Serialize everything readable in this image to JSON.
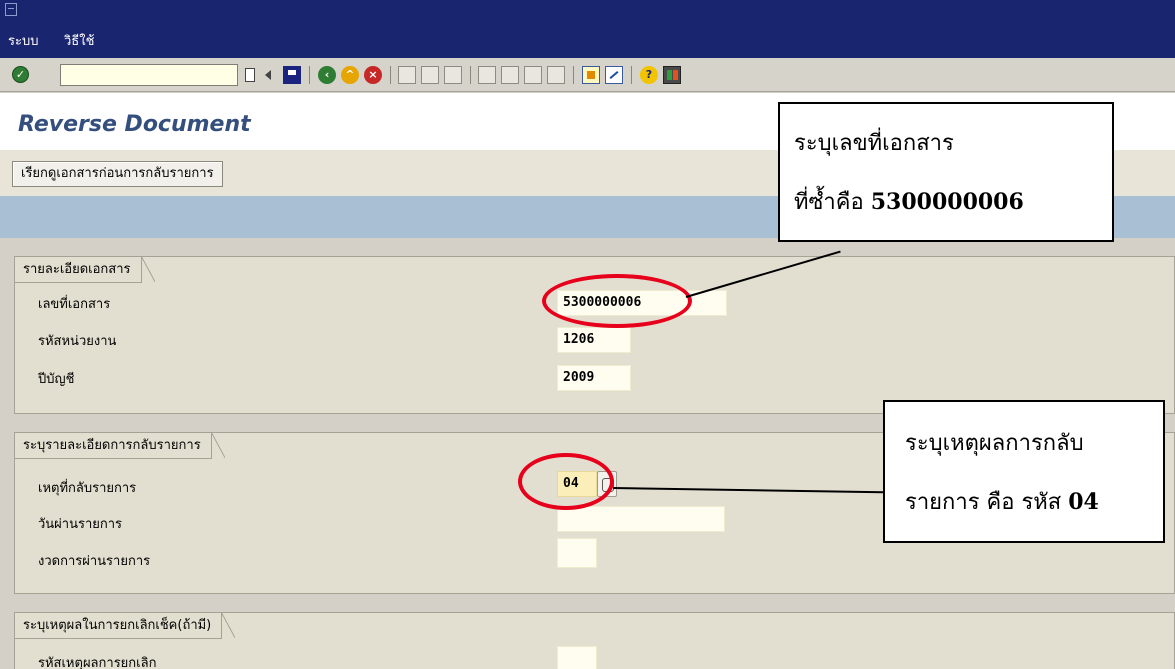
{
  "menu": {
    "items": [
      "ระบบ",
      "วิธีใช้"
    ]
  },
  "toolbar": {
    "command_value": ""
  },
  "page": {
    "title": "Reverse Document"
  },
  "app_toolbar": {
    "button_label": "เรียกดูเอกสารก่อนการกลับรายการ"
  },
  "groups": [
    {
      "title": "รายละเอียดเอกสาร",
      "fields": [
        {
          "label": "เลขที่เอกสาร",
          "value": "5300000006"
        },
        {
          "label": "รหัสหน่วยงาน",
          "value": "1206"
        },
        {
          "label": "ปีบัญชี",
          "value": "2009"
        }
      ]
    },
    {
      "title": "ระบุรายละเอียดการกลับรายการ",
      "fields": [
        {
          "label": "เหตุที่กลับรายการ",
          "value": "04"
        },
        {
          "label": "วันผ่านรายการ",
          "value": ""
        },
        {
          "label": "งวดการผ่านรายการ",
          "value": ""
        }
      ]
    },
    {
      "title": "ระบุเหตุผลในการยกเลิกเช็ค(ถ้ามี)",
      "fields": [
        {
          "label": "รหัสเหตุผลการยกเลิก",
          "value": ""
        }
      ]
    }
  ],
  "annotations": {
    "doc_note": {
      "line1": "ระบุเลขที่เอกสาร",
      "line2_prefix": "ที่ซ้ำคือ ",
      "line2_bold": "5300000006"
    },
    "reason_note": {
      "line1": "ระบุเหตุผลการกลับ",
      "line2_prefix": "รายการ คือ รหัส ",
      "line2_bold": "04"
    },
    "highlight_color": "#e6001c"
  },
  "colors": {
    "menubar": "#1a2570",
    "title": "#344f7e",
    "band": "#a9c0d4",
    "required_field": "#fbeeb8"
  }
}
